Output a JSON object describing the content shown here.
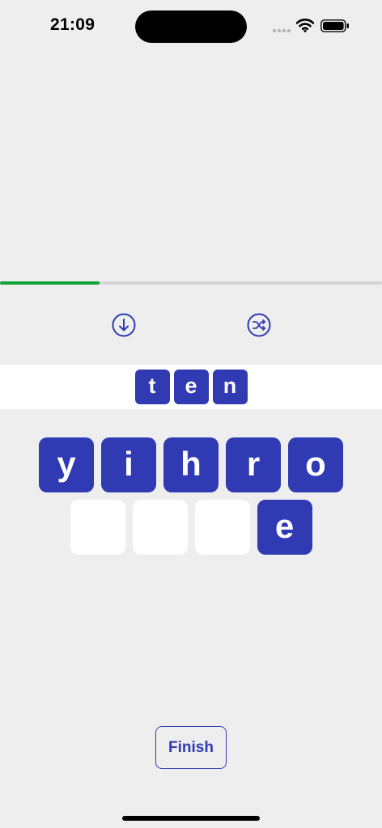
{
  "status_bar": {
    "time": "21:09",
    "icons": [
      "signal-icon",
      "wifi-icon",
      "battery-icon"
    ]
  },
  "progress": {
    "fraction": 0.26,
    "color": "#12a33b",
    "track_color": "#d5d5d5"
  },
  "controls": {
    "left_icon": "arrow-down-circle-icon",
    "right_icon": "shuffle-circle-icon"
  },
  "answer": {
    "letters": [
      "t",
      "e",
      "n"
    ]
  },
  "letters": {
    "row1": [
      "y",
      "i",
      "h",
      "r",
      "o"
    ],
    "row2": [
      "",
      "",
      "",
      "e"
    ]
  },
  "finish": {
    "label": "Finish"
  },
  "colors": {
    "tile": "#2f3ab3",
    "background": "#eeeeee",
    "accent": "#2f3ab3"
  }
}
